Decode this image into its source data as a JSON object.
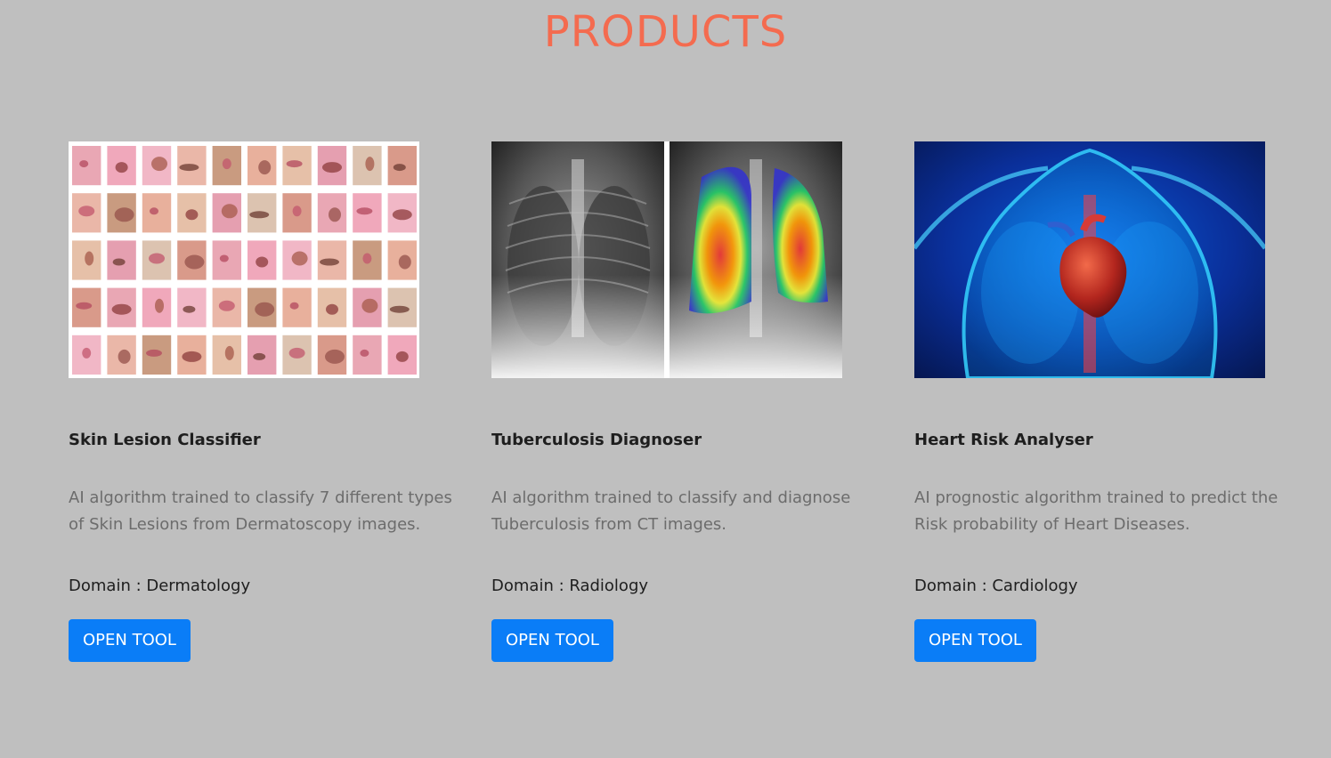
{
  "page": {
    "title": "PRODUCTS"
  },
  "products": [
    {
      "title": "Skin Lesion Classifier",
      "description": "AI algorithm trained to classify 7 different types of Skin Lesions from Dermatoscopy images.",
      "domain": "Domain : Dermatology",
      "button_label": "OPEN TOOL",
      "image": "dermatoscopy-lesion-grid"
    },
    {
      "title": "Tuberculosis Diagnoser",
      "description": "AI algorithm trained to classify and diagnose Tuberculosis from CT images.",
      "domain": "Domain : Radiology",
      "button_label": "OPEN TOOL",
      "image": "chest-xray-heatmap"
    },
    {
      "title": "Heart Risk Analyser",
      "description": "AI prognostic algorithm trained to predict the Risk probability of Heart Diseases.",
      "domain": "Domain : Cardiology",
      "button_label": "OPEN TOOL",
      "image": "heart-anatomy-illustration"
    }
  ],
  "colors": {
    "background": "#bfbfbf",
    "title": "#f46b4f",
    "button": "#0a7df7"
  }
}
